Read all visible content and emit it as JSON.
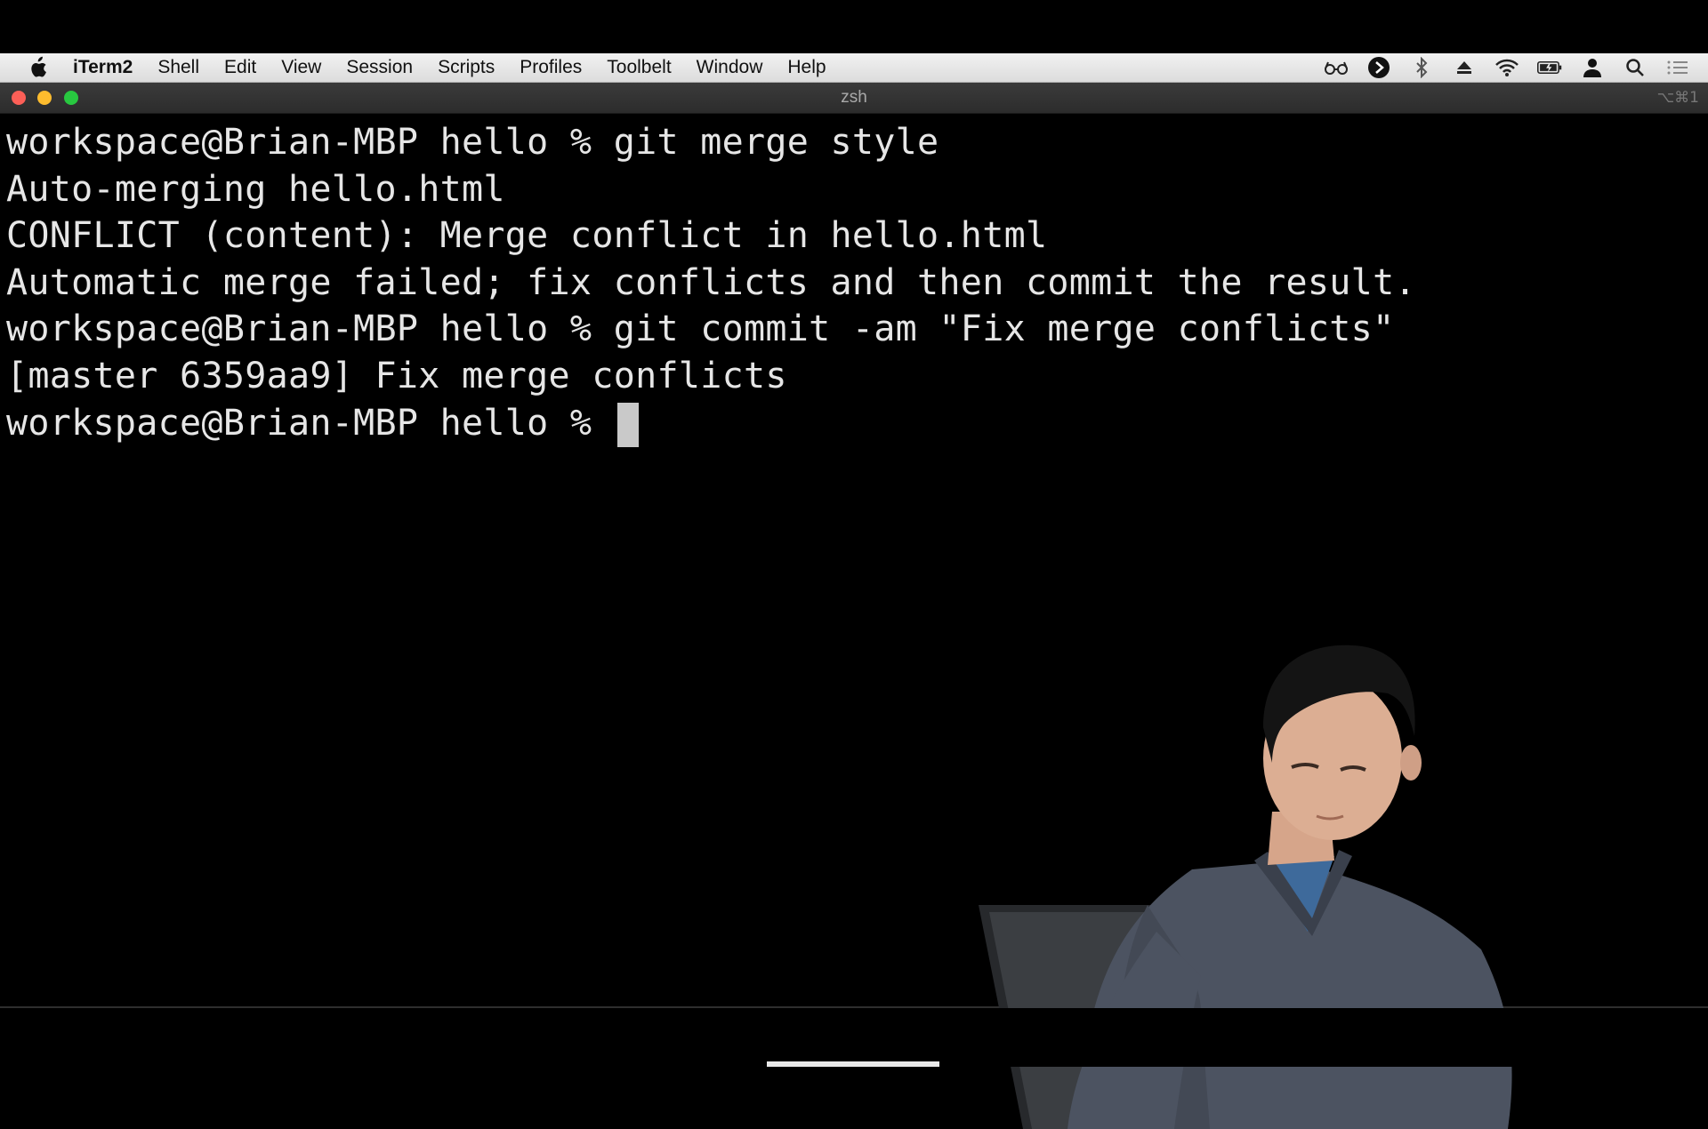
{
  "menubar": {
    "app_name": "iTerm2",
    "items": [
      "Shell",
      "Edit",
      "View",
      "Session",
      "Scripts",
      "Profiles",
      "Toolbelt",
      "Window",
      "Help"
    ],
    "status_icons": [
      "glasses-icon",
      "play-circle-icon",
      "bluetooth-icon",
      "eject-icon",
      "wifi-icon",
      "battery-charging-icon",
      "user-icon",
      "spotlight-search-icon",
      "notification-center-icon"
    ]
  },
  "window": {
    "title": "zsh",
    "shortcut": "⌥⌘1"
  },
  "terminal": {
    "lines": [
      "workspace@Brian-MBP hello % git merge style",
      "Auto-merging hello.html",
      "CONFLICT (content): Merge conflict in hello.html",
      "Automatic merge failed; fix conflicts and then commit the result.",
      "workspace@Brian-MBP hello % git commit -am \"Fix merge conflicts\"",
      "[master 6359aa9] Fix merge conflicts"
    ],
    "prompt": "workspace@Brian-MBP hello % "
  },
  "colors": {
    "terminal_bg": "#000000",
    "terminal_fg": "#e6e6e6",
    "close": "#fc5f57",
    "minimize": "#fdbc2e",
    "maximize": "#28c840"
  }
}
